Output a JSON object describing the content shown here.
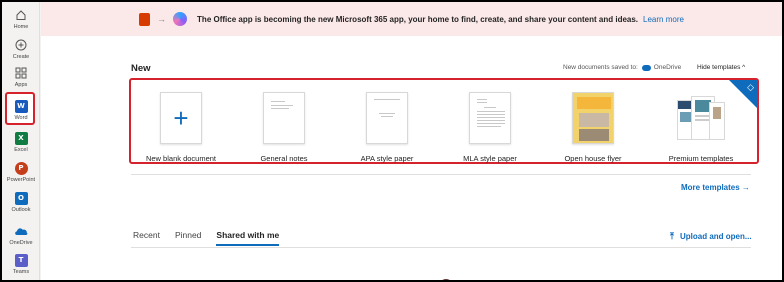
{
  "rail": {
    "items": [
      {
        "label": "Home",
        "icon": "home-icon"
      },
      {
        "label": "Create",
        "icon": "plus-circle-icon"
      },
      {
        "label": "Apps",
        "icon": "apps-grid-icon"
      },
      {
        "label": "Word",
        "icon": "word-icon",
        "letter": "W",
        "color": "#185abd"
      },
      {
        "label": "Excel",
        "icon": "excel-icon",
        "letter": "X",
        "color": "#107c41"
      },
      {
        "label": "PowerPoint",
        "icon": "powerpoint-icon",
        "letter": "P",
        "color": "#c43e1c"
      },
      {
        "label": "Outlook",
        "icon": "outlook-icon",
        "letter": "O",
        "color": "#0f6cbd"
      },
      {
        "label": "OneDrive",
        "icon": "onedrive-icon"
      },
      {
        "label": "Teams",
        "icon": "teams-icon",
        "letter": "T",
        "color": "#5b5fc7"
      }
    ]
  },
  "banner": {
    "text": "The Office app is becoming the new Microsoft 365 app, your home to find, create, and share your content and ideas.",
    "link": "Learn more"
  },
  "new_section": {
    "heading": "New",
    "saved_to_label": "New documents saved to:",
    "saved_to_location": "OneDrive",
    "hide_label": "Hide templates",
    "hide_chevron": "^",
    "templates": [
      {
        "label": "New blank document"
      },
      {
        "label": "General notes"
      },
      {
        "label": "APA style paper"
      },
      {
        "label": "MLA style paper"
      },
      {
        "label": "Open house flyer"
      },
      {
        "label": "Premium templates"
      }
    ],
    "more_templates": "More templates →"
  },
  "files": {
    "tabs": [
      "Recent",
      "Pinned",
      "Shared with me"
    ],
    "active_tab": "Shared with me",
    "upload_label": "Upload and open..."
  },
  "colors": {
    "accent": "#0f6cbd",
    "highlight": "#d6222d",
    "banner_bg": "#fbe8e8"
  }
}
